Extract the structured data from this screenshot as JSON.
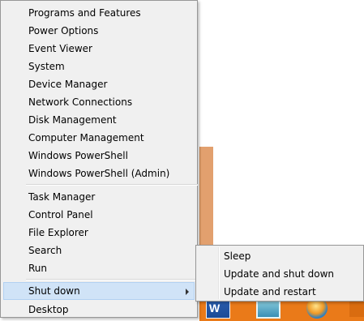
{
  "menu": {
    "items_group1": [
      {
        "label": "Programs and Features"
      },
      {
        "label": "Power Options"
      },
      {
        "label": "Event Viewer"
      },
      {
        "label": "System"
      },
      {
        "label": "Device Manager"
      },
      {
        "label": "Network Connections"
      },
      {
        "label": "Disk Management"
      },
      {
        "label": "Computer Management"
      },
      {
        "label": "Windows PowerShell"
      },
      {
        "label": "Windows PowerShell (Admin)"
      }
    ],
    "items_group2": [
      {
        "label": "Task Manager"
      },
      {
        "label": "Control Panel"
      },
      {
        "label": "File Explorer"
      },
      {
        "label": "Search"
      },
      {
        "label": "Run"
      }
    ],
    "shutdown": {
      "label": "Shut down"
    },
    "desktop": {
      "label": "Desktop"
    }
  },
  "submenu": {
    "items": [
      {
        "label": "Sleep"
      },
      {
        "label": "Update and shut down"
      },
      {
        "label": "Update and restart"
      }
    ]
  },
  "taskbar": {
    "icons": [
      "word-icon",
      "screen-icon",
      "media-player-icon"
    ],
    "word_glyph": "W",
    "color": "#ea7a19"
  },
  "colors": {
    "menu_bg": "#f0f0f0",
    "highlight": "#d0e3f7",
    "highlight_border": "#b2d1f2"
  }
}
